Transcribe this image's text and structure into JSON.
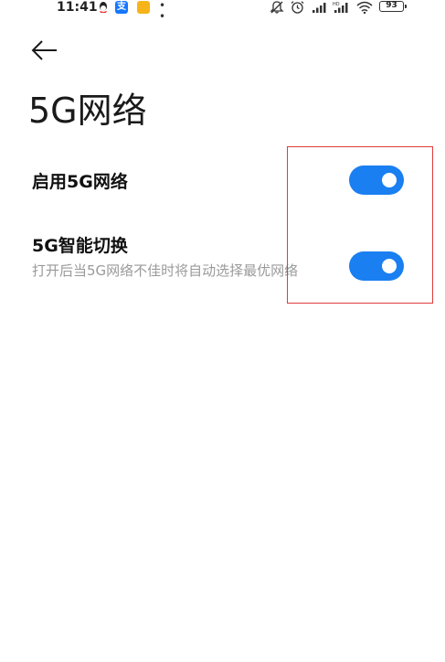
{
  "status_bar": {
    "time": "11:41",
    "left_icons": [
      "qq-icon",
      "alipay-icon",
      "notes-icon",
      "more-dots-icon"
    ],
    "alipay_glyph": "支",
    "more_dots": "• •",
    "right_icons": [
      "mute-bell-icon",
      "alarm-icon",
      "signal-icon",
      "signal-hd-icon",
      "wifi-icon",
      "battery-icon"
    ],
    "battery_level": "93"
  },
  "header": {
    "back_icon": "back-arrow-icon",
    "title": "5G网络"
  },
  "settings": [
    {
      "title": "启用5G网络",
      "description": "",
      "enabled": true
    },
    {
      "title": "5G智能切换",
      "description": "打开后当5G网络不佳时将自动选择最优网络",
      "enabled": true
    }
  ],
  "colors": {
    "toggle_on": "#1a7ff0",
    "highlight": "#e03b3b",
    "description_text": "#9a9a9a"
  }
}
